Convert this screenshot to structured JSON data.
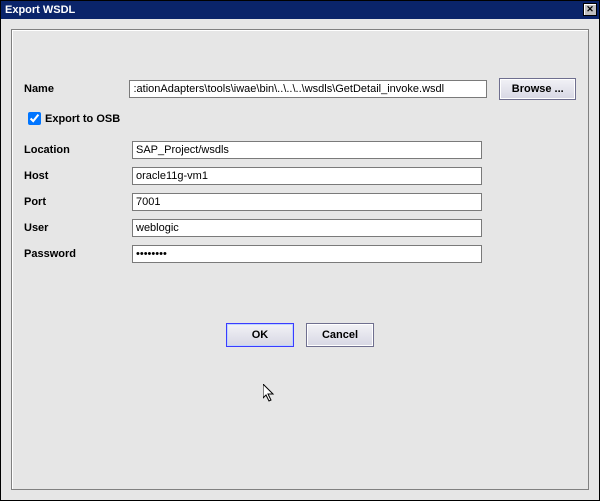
{
  "title": "Export WSDL",
  "labels": {
    "name": "Name",
    "exportToOsb": "Export to OSB",
    "location": "Location",
    "host": "Host",
    "port": "Port",
    "user": "User",
    "password": "Password"
  },
  "fields": {
    "name": ":ationAdapters\\tools\\iwae\\bin\\..\\..\\..\\wsdls\\GetDetail_invoke.wsdl",
    "exportToOsb": true,
    "location": "SAP_Project/wsdls",
    "host": "oracle11g-vm1",
    "port": "7001",
    "user": "weblogic",
    "password": "••••••••"
  },
  "buttons": {
    "browse": "Browse ...",
    "ok": "OK",
    "cancel": "Cancel"
  }
}
